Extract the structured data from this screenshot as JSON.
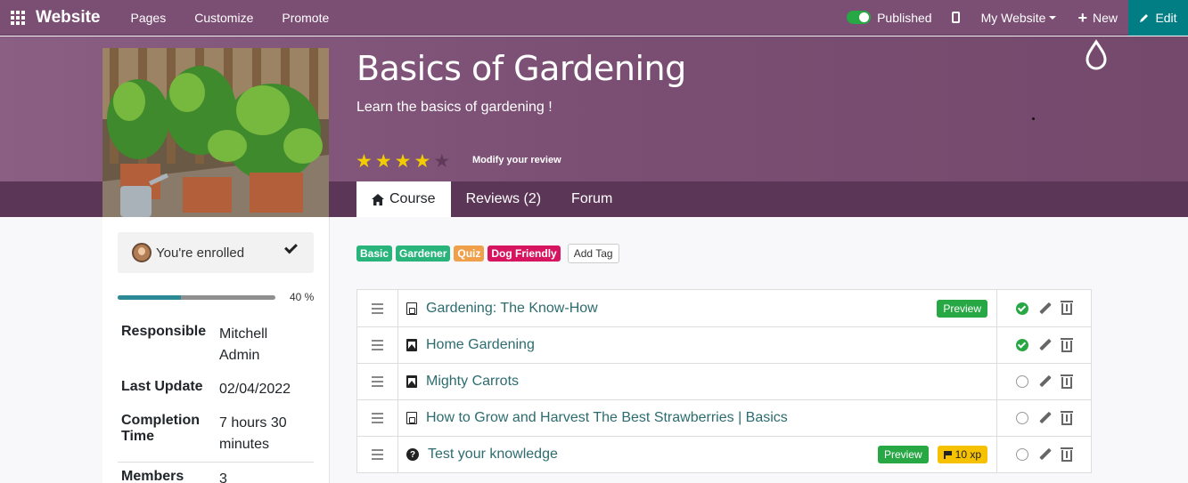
{
  "topbar": {
    "brand": "Website",
    "menu": [
      "Pages",
      "Customize",
      "Promote"
    ],
    "published_label": "Published",
    "my_website_label": "My Website",
    "new_label": "New",
    "edit_label": "Edit"
  },
  "course": {
    "title": "Basics of Gardening",
    "subtitle": "Learn the basics of gardening !",
    "rating": 4,
    "rating_max": 5,
    "modify_review": "Modify your review",
    "tabs": [
      {
        "label": "Course",
        "active": true
      },
      {
        "label": "Reviews (2)",
        "active": false
      },
      {
        "label": "Forum",
        "active": false
      }
    ]
  },
  "sidebar": {
    "enrolled_text": "You're enrolled",
    "progress_value": 0.4,
    "progress_label": "40 %",
    "info": [
      {
        "key": "Responsible",
        "value": "Mitchell Admin"
      },
      {
        "key": "Last Update",
        "value": "02/04/2022"
      },
      {
        "key": "Completion Time",
        "value": "7 hours 30 minutes"
      },
      {
        "key": "Members",
        "value": "3"
      }
    ]
  },
  "tags": [
    {
      "label": "Basic",
      "color": "#28b47b"
    },
    {
      "label": "Gardener",
      "color": "#28b47b"
    },
    {
      "label": "Quiz",
      "color": "#f0a04b"
    },
    {
      "label": "Dog Friendly",
      "color": "#d6145f"
    }
  ],
  "add_tag_label": "Add Tag",
  "slides": [
    {
      "name": "Gardening: The Know-How",
      "icon": "pdf-icon",
      "preview": "Preview",
      "xp": "",
      "completed": true
    },
    {
      "name": "Home Gardening",
      "icon": "image-icon",
      "preview": "",
      "xp": "",
      "completed": true
    },
    {
      "name": "Mighty Carrots",
      "icon": "image-icon",
      "preview": "",
      "xp": "",
      "completed": false
    },
    {
      "name": "How to Grow and Harvest The Best Strawberries | Basics",
      "icon": "pdf-icon",
      "preview": "",
      "xp": "",
      "completed": false
    },
    {
      "name": "Test your knowledge",
      "icon": "quiz-icon",
      "preview": "Preview",
      "xp": "10 xp",
      "completed": false
    }
  ]
}
